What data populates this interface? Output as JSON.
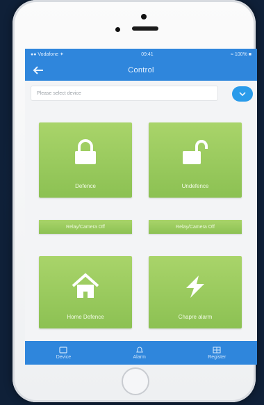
{
  "status_bar": {
    "carrier": "●● Vodafone ✦",
    "time": "09:41",
    "battery": "≈ 100% ■"
  },
  "nav": {
    "title": "Control"
  },
  "device": {
    "placeholder": "Please select device"
  },
  "tiles": [
    {
      "label": "Defence"
    },
    {
      "label": "Undefence"
    },
    {
      "label": "Home Defence"
    },
    {
      "label": "Chapre alarm"
    }
  ],
  "bars": [
    {
      "label": "Relay/Camera Off"
    },
    {
      "label": "Relay/Camera Off"
    }
  ],
  "tabbar": {
    "items": [
      {
        "label": "Device"
      },
      {
        "label": "Alarm"
      },
      {
        "label": "Register"
      }
    ]
  },
  "colors": {
    "primary": "#2f86dc",
    "tile": "#8cc153",
    "accent": "#2a9bea"
  }
}
